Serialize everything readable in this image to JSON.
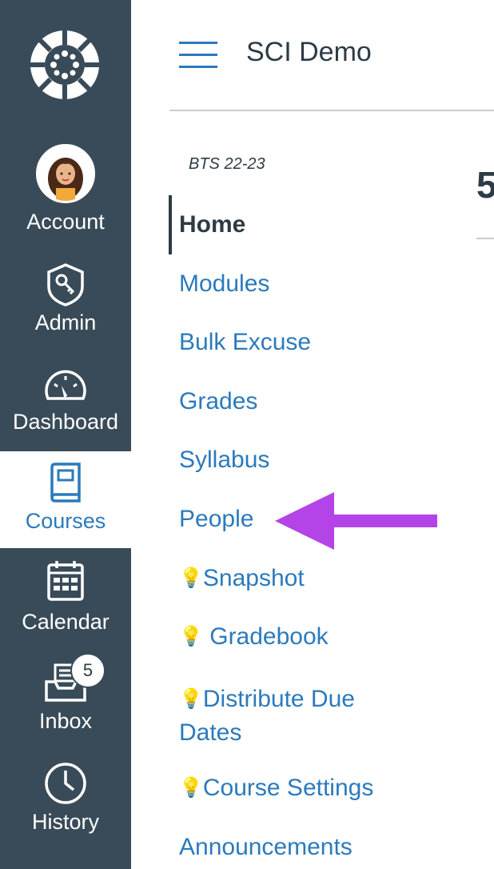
{
  "global_nav": {
    "items": [
      {
        "label": "Account",
        "icon": "avatar"
      },
      {
        "label": "Admin",
        "icon": "shield-key-icon"
      },
      {
        "label": "Dashboard",
        "icon": "speedometer-icon"
      },
      {
        "label": "Courses",
        "icon": "book-icon",
        "active": true
      },
      {
        "label": "Calendar",
        "icon": "calendar-icon"
      },
      {
        "label": "Inbox",
        "icon": "inbox-icon",
        "badge": "5"
      },
      {
        "label": "History",
        "icon": "clock-icon"
      }
    ],
    "logo": "canvas-logo-icon",
    "background": "#394b58"
  },
  "header": {
    "course_title": "SCI Demo",
    "menu_icon": "hamburger-icon"
  },
  "course_nav": {
    "term": "BTS 22-23",
    "items": [
      {
        "label": "Home",
        "active": true
      },
      {
        "label": "Modules"
      },
      {
        "label": "Bulk Excuse"
      },
      {
        "label": "Grades"
      },
      {
        "label": "Syllabus"
      },
      {
        "label": "People"
      },
      {
        "label": "Snapshot",
        "icon": "lightbulb-icon"
      },
      {
        "label": "Gradebook",
        "icon": "lightbulb-icon"
      },
      {
        "label": "Distribute Due",
        "label2": "Dates",
        "icon": "lightbulb-icon"
      },
      {
        "label": "Course Settings",
        "icon": "lightbulb-icon"
      },
      {
        "label": "Announcements"
      }
    ],
    "link_color": "#2b7abc"
  },
  "content": {
    "partial_text": "5"
  },
  "annotation": {
    "arrow_color": "#b544e8",
    "points_to": "People"
  }
}
